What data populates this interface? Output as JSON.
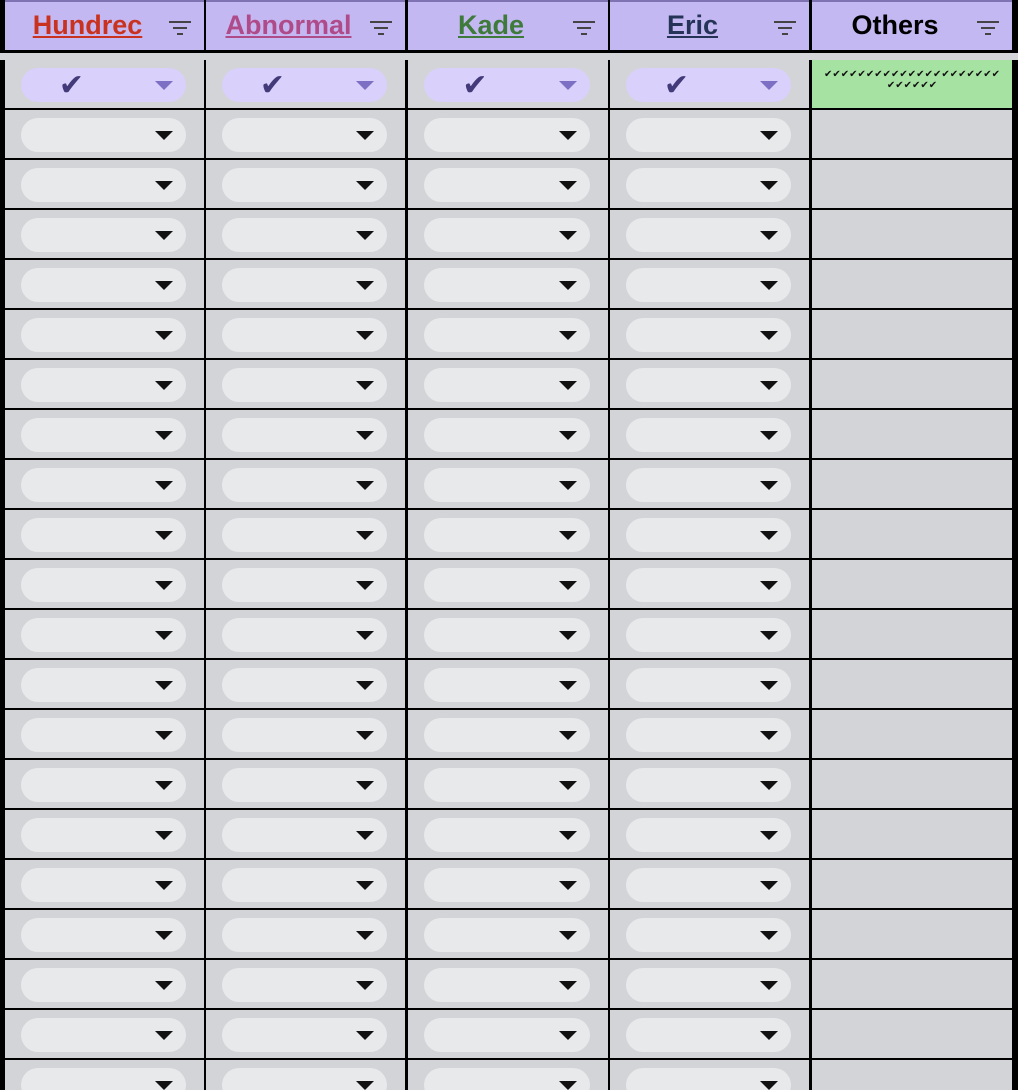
{
  "columns": [
    {
      "name": "Hundrec",
      "color": "#c8321e"
    },
    {
      "name": "Abnormal",
      "color": "#b04b89"
    },
    {
      "name": "Kade",
      "color": "#3e7a3a"
    },
    {
      "name": "Eric",
      "color": "#253456"
    },
    {
      "name": "Others",
      "color": "#000000"
    }
  ],
  "first_row": {
    "values": [
      "✔",
      "✔",
      "✔",
      "✔"
    ],
    "others": "✔✔✔✔✔✔✔✔✔✔✔✔✔✔✔✔✔✔✔✔✔✔✔✔✔✔✔"
  },
  "empty_row_count": 20,
  "icons": {
    "filter": "filter-icon",
    "dropdown": "chevron-down-icon"
  },
  "colors": {
    "header_bg": "#c4b8f3",
    "cell_bg": "#d3d4d8",
    "pill_bg": "#e8e9eb",
    "selected_pill_bg": "#d9d0fb",
    "others_selected_bg": "#a6e2a2"
  }
}
